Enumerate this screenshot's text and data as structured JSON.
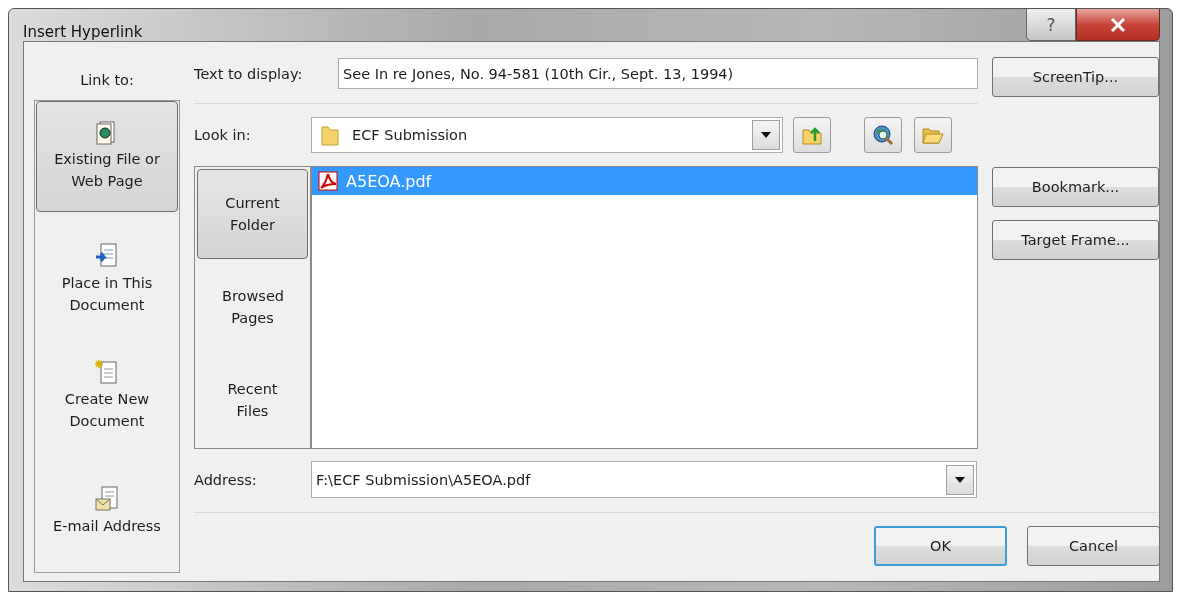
{
  "window": {
    "title": "Insert Hyperlink",
    "help": "?"
  },
  "link_to": {
    "label": "Link to:",
    "items": [
      {
        "kind": "file",
        "label": "Existing File or Web Page",
        "selected": true
      },
      {
        "kind": "place",
        "label": "Place in This Document",
        "selected": false
      },
      {
        "kind": "new",
        "label": "Create New Document",
        "selected": false
      },
      {
        "kind": "email",
        "label": "E-mail Address",
        "selected": false
      }
    ]
  },
  "text_to_display": {
    "label": "Text to display:",
    "value": "See In re Jones, No. 94-581 (10th Cir., Sept. 13, 1994)"
  },
  "look_in": {
    "label": "Look in:",
    "value": "ECF Submission"
  },
  "browse_tabs": [
    {
      "label": "Current Folder",
      "selected": true
    },
    {
      "label": "Browsed Pages",
      "selected": false
    },
    {
      "label": "Recent Files",
      "selected": false
    }
  ],
  "files": [
    {
      "name": "A5EOA.pdf",
      "selected": true
    }
  ],
  "address": {
    "label": "Address:",
    "value": "F:\\ECF Submission\\A5EOA.pdf"
  },
  "side_buttons": [
    "ScreenTip...",
    "Bookmark...",
    "Target Frame..."
  ],
  "buttons": [
    {
      "label": "OK",
      "default": true
    },
    {
      "label": "Cancel",
      "default": false
    }
  ]
}
